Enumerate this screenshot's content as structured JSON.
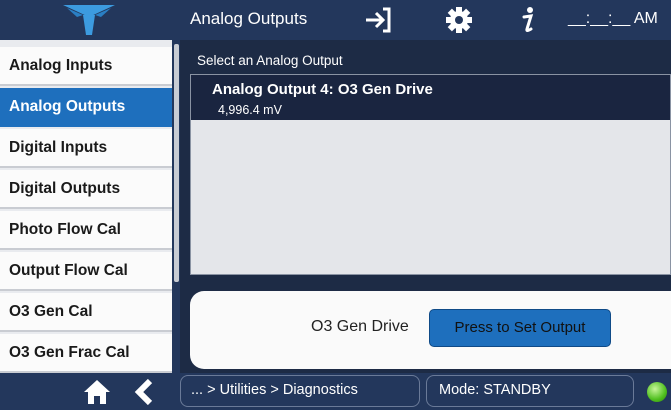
{
  "header": {
    "title": "Analog Outputs",
    "time": "__:__:__ AM",
    "icons": [
      "logo-icon",
      "exit-icon",
      "gear-icon",
      "info-icon"
    ]
  },
  "sidebar": {
    "items": [
      {
        "label": "Analog Inputs"
      },
      {
        "label": "Analog Outputs",
        "active": true
      },
      {
        "label": "Digital Inputs"
      },
      {
        "label": "Digital Outputs"
      },
      {
        "label": "Photo Flow Cal"
      },
      {
        "label": "Output Flow Cal"
      },
      {
        "label": "O3 Gen Cal"
      },
      {
        "label": "O3 Gen Frac Cal"
      }
    ]
  },
  "main": {
    "select_label": "Select an Analog Output",
    "list": [
      {
        "title": "Analog Output 4: O3 Gen Drive",
        "value": "4,996.4 mV"
      }
    ],
    "control": {
      "label": "O3 Gen Drive",
      "button": "Press to Set Output"
    }
  },
  "footer": {
    "breadcrumb": "... > Utilities > Diagnostics",
    "mode": "Mode: STANDBY",
    "icons": [
      "home-icon",
      "back-icon",
      "status-led"
    ]
  },
  "colors": {
    "header_bg": "#23375c",
    "accent": "#1e6fbd",
    "status_ok": "#4fbf1e"
  }
}
